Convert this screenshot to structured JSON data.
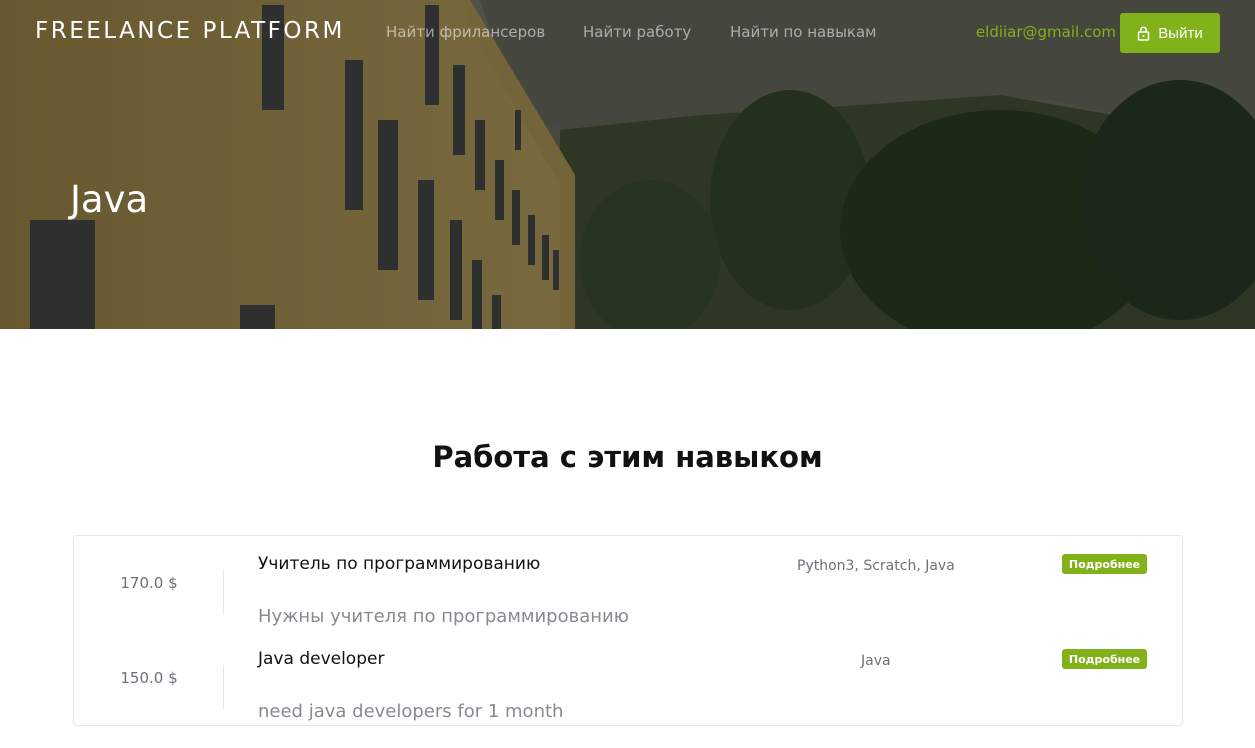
{
  "navbar": {
    "brand": "FREELANCE PLATFORM",
    "links": [
      {
        "label": "Найти фрилансеров"
      },
      {
        "label": "Найти работу"
      },
      {
        "label": "Найти по навыкам"
      }
    ],
    "user_email": "eldiiar@gmail.com",
    "logout_label": "Выйти",
    "logout_icon": "lock-icon"
  },
  "hero": {
    "title": "Java"
  },
  "section": {
    "title": "Работа с этим навыком"
  },
  "jobs": [
    {
      "price": "170.0 $",
      "title": "Учитель по программированию",
      "skills": "Python3, Scratch, Java",
      "description": "Нужны учителя по программированию",
      "more_label": "Подробнее"
    },
    {
      "price": "150.0 $",
      "title": "Java developer",
      "skills": "Java",
      "description": "need java developers for 1 month",
      "more_label": "Подробнее"
    }
  ],
  "colors": {
    "accent": "#82b21a",
    "text_dark": "#111111",
    "text_muted": "#868b90"
  }
}
